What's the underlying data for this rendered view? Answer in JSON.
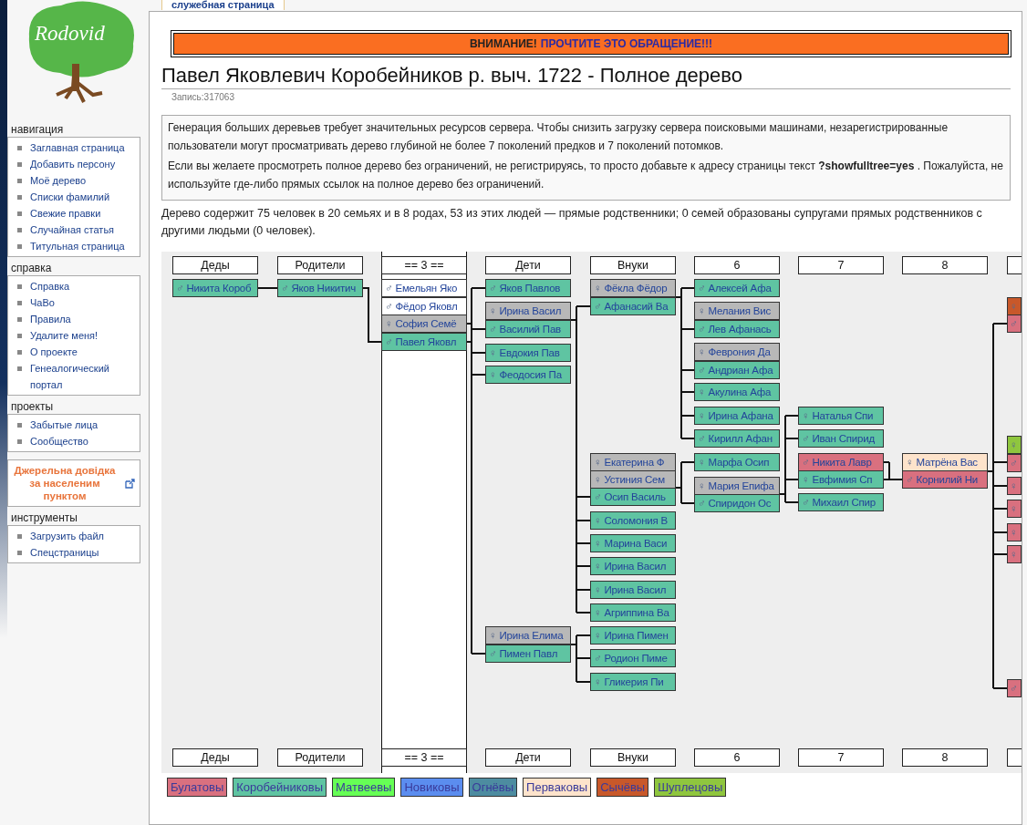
{
  "tab": {
    "label": "служебная страница"
  },
  "logo": {
    "text": "Rodovid"
  },
  "sidebar": [
    {
      "kind": "list",
      "heading": "навигация",
      "items": [
        "Заглавная страница",
        "Добавить персону",
        "Моё дерево",
        "Списки фамилий",
        "Свежие правки",
        "Случайная статья",
        "Титульная страница"
      ]
    },
    {
      "kind": "list",
      "heading": "справка",
      "items": [
        "Справка",
        "ЧаВо",
        "Правила",
        "Удалите меня!",
        "О проекте",
        "Генеалогический портал"
      ]
    },
    {
      "kind": "list",
      "heading": "проекты",
      "items": [
        "Забытые лица",
        "Сообщество"
      ]
    },
    {
      "kind": "promo",
      "text": "Джерельна довідка за населеним пунктом"
    },
    {
      "kind": "list",
      "heading": "инструменты",
      "items": [
        "Загрузить файл",
        "Спецстраницы"
      ]
    }
  ],
  "notice": {
    "label": "ВНИМАНИЕ!",
    "link": "ПРОЧТИТЕ ЭТО ОБРАЩЕНИЕ!!!"
  },
  "title": "Павел Яковлевич Коробейников р. выч. 1722 - Полное дерево",
  "record": "Запись:317063",
  "info": [
    "Генерация больших деревьев требует значительных ресурсов сервера. Чтобы снизить загрузку сервера поисковыми машинами, незарегистрированные пользователи могут просматривать дерево глубиной не более 7 поколений предков и 7 поколений потомков.",
    "Если вы желаете просмотреть полное дерево без ограничений, не регистрируясь, то просто добавьте к адресу страницы текст **?showfulltree=yes** . Пожалуйста, не используйте где-либо прямых ссылок на полное дерево без ограничений."
  ],
  "summary": "Дерево содержит 75 человек в 20 семьях и в 8 родах, 53 из этих людей — прямые родственники; 0 семей образованы супругами прямых родственников с другими людьми (0 человек).",
  "tree": {
    "headers": [
      "Деды",
      "Родители",
      "== 3 ==",
      "Дети",
      "Внуки",
      "6",
      "7",
      "8"
    ],
    "footer_headers": [
      "Деды",
      "Родители",
      "== 3 ==",
      "Дети",
      "Внуки",
      "6",
      "7",
      "8"
    ],
    "columns": [
      {
        "nodes": [
          {
            "symbol": "♂",
            "name": "Никита Короб",
            "color": "#5fc4a2"
          }
        ]
      },
      {
        "nodes": [
          {
            "symbol": "♂",
            "name": "Яков Никитич",
            "color": "#5fc4a2"
          }
        ]
      },
      {
        "nodes": [
          {
            "symbol": "♂",
            "name": "Емельян Яко",
            "color": "#ffffff"
          },
          {
            "symbol": "♂",
            "name": "Фёдор Яковл",
            "color": "#ffffff"
          },
          {
            "symbol": "♀",
            "name": "София Семё",
            "color": "#b8b8b8"
          },
          {
            "symbol": "♂",
            "name": "Павел Яковл",
            "color": "#5fc4a2"
          }
        ]
      },
      {
        "nodes": [
          {
            "symbol": "♂",
            "name": "Яков Павлов",
            "color": "#5fc4a2"
          },
          {
            "symbol": "♀",
            "name": "Ирина Васил",
            "color": "#b8b8b8"
          },
          {
            "symbol": "♂",
            "name": "Василий Пав",
            "color": "#5fc4a2"
          },
          {
            "symbol": "♀",
            "name": "Евдокия Пав",
            "color": "#5fc4a2"
          },
          {
            "symbol": "♀",
            "name": "Феодосия Па",
            "color": "#5fc4a2"
          },
          {
            "symbol": "♀",
            "name": "Ирина Елима",
            "color": "#b8b8b8"
          },
          {
            "symbol": "♂",
            "name": "Пимен Павл",
            "color": "#5fc4a2"
          }
        ]
      },
      {
        "nodes": [
          {
            "symbol": "♀",
            "name": "Фёкла Фёдор",
            "color": "#b8b8b8"
          },
          {
            "symbol": "♂",
            "name": "Афанасий Ва",
            "color": "#5fc4a2"
          },
          {
            "symbol": "♀",
            "name": "Екатерина Ф",
            "color": "#b8b8b8"
          },
          {
            "symbol": "♀",
            "name": "Устиния Сем",
            "color": "#b8b8b8"
          },
          {
            "symbol": "♂",
            "name": "Осип Василь",
            "color": "#5fc4a2"
          },
          {
            "symbol": "♀",
            "name": "Соломония В",
            "color": "#5fc4a2"
          },
          {
            "symbol": "♀",
            "name": "Марина Васи",
            "color": "#5fc4a2"
          },
          {
            "symbol": "♀",
            "name": "Ирина Васил",
            "color": "#5fc4a2"
          },
          {
            "symbol": "♀",
            "name": "Ирина Васил",
            "color": "#5fc4a2"
          },
          {
            "symbol": "♀",
            "name": "Агриппина Ва",
            "color": "#5fc4a2"
          },
          {
            "symbol": "♀",
            "name": "Ирина Пимен",
            "color": "#5fc4a2"
          },
          {
            "symbol": "♂",
            "name": "Родион Пиме",
            "color": "#5fc4a2"
          },
          {
            "symbol": "♀",
            "name": "Гликерия Пи",
            "color": "#5fc4a2"
          }
        ]
      },
      {
        "nodes": [
          {
            "symbol": "♂",
            "name": "Алексей Афа",
            "color": "#5fc4a2"
          },
          {
            "symbol": "♀",
            "name": "Мелания Вис",
            "color": "#b8b8b8"
          },
          {
            "symbol": "♂",
            "name": "Лев Афанась",
            "color": "#5fc4a2"
          },
          {
            "symbol": "♀",
            "name": "Феврония Да",
            "color": "#b8b8b8"
          },
          {
            "symbol": "♂",
            "name": "Андриан Афа",
            "color": "#5fc4a2"
          },
          {
            "symbol": "♀",
            "name": "Акулина Афа",
            "color": "#5fc4a2"
          },
          {
            "symbol": "♀",
            "name": "Ирина Афана",
            "color": "#5fc4a2"
          },
          {
            "symbol": "♂",
            "name": "Кирилл Афан",
            "color": "#5fc4a2"
          },
          {
            "symbol": "♀",
            "name": "Марфа Осип",
            "color": "#5fc4a2"
          },
          {
            "symbol": "♀",
            "name": "Мария Епифа",
            "color": "#b8b8b8"
          },
          {
            "symbol": "♂",
            "name": "Спиридон Ос",
            "color": "#5fc4a2"
          }
        ]
      },
      {
        "nodes": [
          {
            "symbol": "♀",
            "name": "Наталья Спи",
            "color": "#5fc4a2"
          },
          {
            "symbol": "♂",
            "name": "Иван Спирид",
            "color": "#5fc4a2"
          },
          {
            "symbol": "♂",
            "name": "Никита Лавр",
            "color": "#d9707f"
          },
          {
            "symbol": "♀",
            "name": "Евфимия Сп",
            "color": "#5fc4a2"
          },
          {
            "symbol": "♂",
            "name": "Михаил Спир",
            "color": "#5fc4a2"
          }
        ]
      },
      {
        "nodes": [
          {
            "symbol": "♀",
            "name": "Матрёна Вас",
            "color": "#fde3cb"
          },
          {
            "symbol": "♂",
            "name": "Корнилий Ни",
            "color": "#d9707f"
          }
        ]
      },
      {
        "nodes": [
          {
            "symbol": "♀",
            "color": "#c8582a"
          },
          {
            "symbol": "♂",
            "color": "#d9707f"
          },
          {
            "symbol": "♀",
            "color": "#8fc63e"
          },
          {
            "symbol": "♂",
            "color": "#d9707f"
          },
          {
            "symbol": "♀",
            "color": "#d9707f"
          },
          {
            "symbol": "♀",
            "color": "#d9707f"
          },
          {
            "symbol": "♀",
            "color": "#d9707f"
          },
          {
            "symbol": "♀",
            "color": "#d9707f"
          },
          {
            "symbol": "♂",
            "color": "#d9707f"
          }
        ]
      }
    ]
  },
  "legend": [
    {
      "label": "Булатовы",
      "color": "#d9707f"
    },
    {
      "label": "Коробейниковы",
      "color": "#5fc4a2"
    },
    {
      "label": "Матвеевы",
      "color": "#66ff55"
    },
    {
      "label": "Новиковы",
      "color": "#5b8def"
    },
    {
      "label": "Огнёвы",
      "color": "#4d8ca0"
    },
    {
      "label": "Перваковы",
      "color": "#fde3cb"
    },
    {
      "label": "Сычёвы",
      "color": "#c8582a"
    },
    {
      "label": "Шуплецовы",
      "color": "#8fc63e"
    }
  ]
}
